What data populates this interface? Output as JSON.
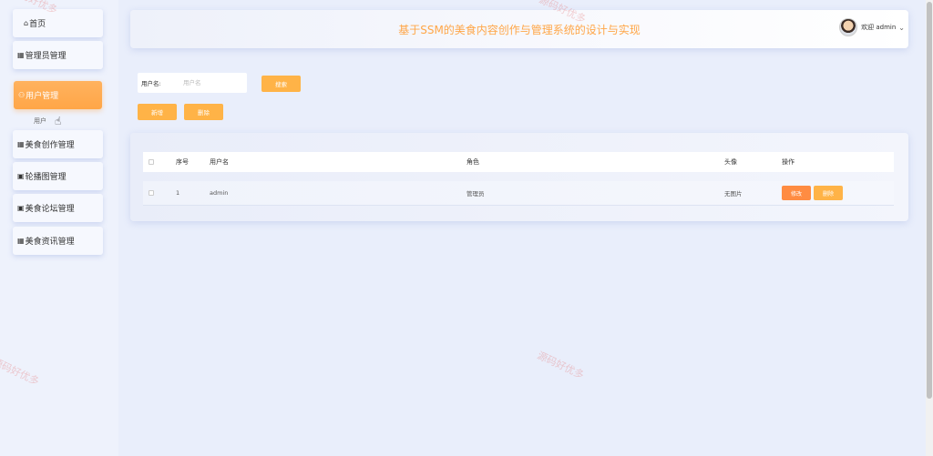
{
  "sidebar": {
    "items": [
      {
        "icon": "home-icon",
        "glyph": "⌂",
        "label": "首页"
      },
      {
        "icon": "table-icon",
        "glyph": "▦",
        "label": "管理员管理"
      },
      {
        "icon": "user-icon",
        "glyph": "⚇",
        "label": "用户管理"
      },
      {
        "icon": "grid-icon",
        "glyph": "▦",
        "label": "美食创作管理"
      },
      {
        "icon": "image-icon",
        "glyph": "▣",
        "label": "轮播图管理"
      },
      {
        "icon": "forum-icon",
        "glyph": "▣",
        "label": "美食论坛管理"
      },
      {
        "icon": "grid-icon",
        "glyph": "▦",
        "label": "美食资讯管理"
      }
    ],
    "submenu": {
      "label": "用户"
    }
  },
  "header": {
    "title": "基于SSM的美食内容创作与管理系统的设计与实现",
    "user_label": "欢迎 admin"
  },
  "search": {
    "label": "用户名:",
    "placeholder": "用户名",
    "search_button": "搜索",
    "add_button": "新增",
    "delete_button": "删除"
  },
  "table": {
    "headers": [
      "序号",
      "用户名",
      "角色",
      "头像",
      "操作"
    ],
    "rows": [
      {
        "index": "1",
        "username": "admin",
        "role": "管理员",
        "avatar": "无图片",
        "edit": "修改",
        "delete": "删除"
      }
    ]
  },
  "watermark": "源码好优多",
  "colors": {
    "accent": "#ffa647",
    "edit": "#ff8c42"
  }
}
